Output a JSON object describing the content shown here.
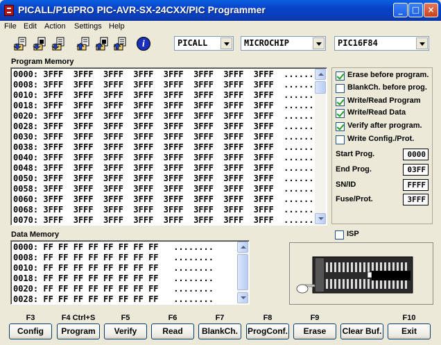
{
  "window": {
    "title": "PICALL/P16PRO PIC-AVR-SX-24CXX/PIC Programmer",
    "minimize": "_",
    "maximize": "□",
    "close": "×"
  },
  "menu": [
    "File",
    "Edit",
    "Action",
    "Settings",
    "Help"
  ],
  "toolbar": {
    "icons": [
      "open-file-icon",
      "open-program-icon",
      "open-data-icon",
      "save-file-icon",
      "save-program-icon",
      "save-data-icon",
      "info-icon"
    ],
    "info_glyph": "i"
  },
  "selectors": {
    "programmer": "PICALL",
    "manufacturer": "MICROCHIP",
    "device": "PIC16F84"
  },
  "program_memory": {
    "label": "Program Memory",
    "rows": [
      "0000: 3FFF  3FFF  3FFF  3FFF  3FFF  3FFF  3FFF  3FFF  ........",
      "0008: 3FFF  3FFF  3FFF  3FFF  3FFF  3FFF  3FFF  3FFF  ........",
      "0010: 3FFF  3FFF  3FFF  3FFF  3FFF  3FFF  3FFF  3FFF  ........",
      "0018: 3FFF  3FFF  3FFF  3FFF  3FFF  3FFF  3FFF  3FFF  ........",
      "0020: 3FFF  3FFF  3FFF  3FFF  3FFF  3FFF  3FFF  3FFF  ........",
      "0028: 3FFF  3FFF  3FFF  3FFF  3FFF  3FFF  3FFF  3FFF  ........",
      "0030: 3FFF  3FFF  3FFF  3FFF  3FFF  3FFF  3FFF  3FFF  ........",
      "0038: 3FFF  3FFF  3FFF  3FFF  3FFF  3FFF  3FFF  3FFF  ........",
      "0040: 3FFF  3FFF  3FFF  3FFF  3FFF  3FFF  3FFF  3FFF  ........",
      "0048: 3FFF  3FFF  3FFF  3FFF  3FFF  3FFF  3FFF  3FFF  ........",
      "0050: 3FFF  3FFF  3FFF  3FFF  3FFF  3FFF  3FFF  3FFF  ........",
      "0058: 3FFF  3FFF  3FFF  3FFF  3FFF  3FFF  3FFF  3FFF  ........",
      "0060: 3FFF  3FFF  3FFF  3FFF  3FFF  3FFF  3FFF  3FFF  ........",
      "0068: 3FFF  3FFF  3FFF  3FFF  3FFF  3FFF  3FFF  3FFF  ........",
      "0070: 3FFF  3FFF  3FFF  3FFF  3FFF  3FFF  3FFF  3FFF  ........"
    ]
  },
  "data_memory": {
    "label": "Data Memory",
    "rows": [
      "0000: FF FF FF FF FF FF FF FF   ........",
      "0008: FF FF FF FF FF FF FF FF   ........",
      "0010: FF FF FF FF FF FF FF FF   ........",
      "0018: FF FF FF FF FF FF FF FF   ........",
      "0020: FF FF FF FF FF FF FF FF   ........",
      "0028: FF FF FF FF FF FF FF FF   ........"
    ]
  },
  "options": {
    "checkboxes": [
      {
        "label": "Erase before program.",
        "checked": true
      },
      {
        "label": "BlankCh. before prog.",
        "checked": false
      },
      {
        "label": "Write/Read Program",
        "checked": true
      },
      {
        "label": "Write/Read Data",
        "checked": true
      },
      {
        "label": "Verify after program.",
        "checked": true
      },
      {
        "label": "Write Config./Prot.",
        "checked": false
      }
    ],
    "fields": [
      {
        "label": "Start Prog.",
        "value": "0000"
      },
      {
        "label": "End Prog.",
        "value": "03FF"
      },
      {
        "label": "SN/ID",
        "value": "FFFF"
      },
      {
        "label": "Fuse/Prot.",
        "value": "3FFF"
      }
    ]
  },
  "isp": {
    "label": "ISP",
    "checked": false
  },
  "function_keys": [
    {
      "key": "F3",
      "label": "Config"
    },
    {
      "key": "F4 Ctrl+S",
      "label": "Program"
    },
    {
      "key": "F5",
      "label": "Verify"
    },
    {
      "key": "F6",
      "label": "Read"
    },
    {
      "key": "F7",
      "label": "BlankCh."
    },
    {
      "key": "F8",
      "label": "ProgConf."
    },
    {
      "key": "F9",
      "label": "Erase"
    },
    {
      "key": "",
      "label": "Clear Buf."
    },
    {
      "key": "F10",
      "label": "Exit"
    }
  ]
}
